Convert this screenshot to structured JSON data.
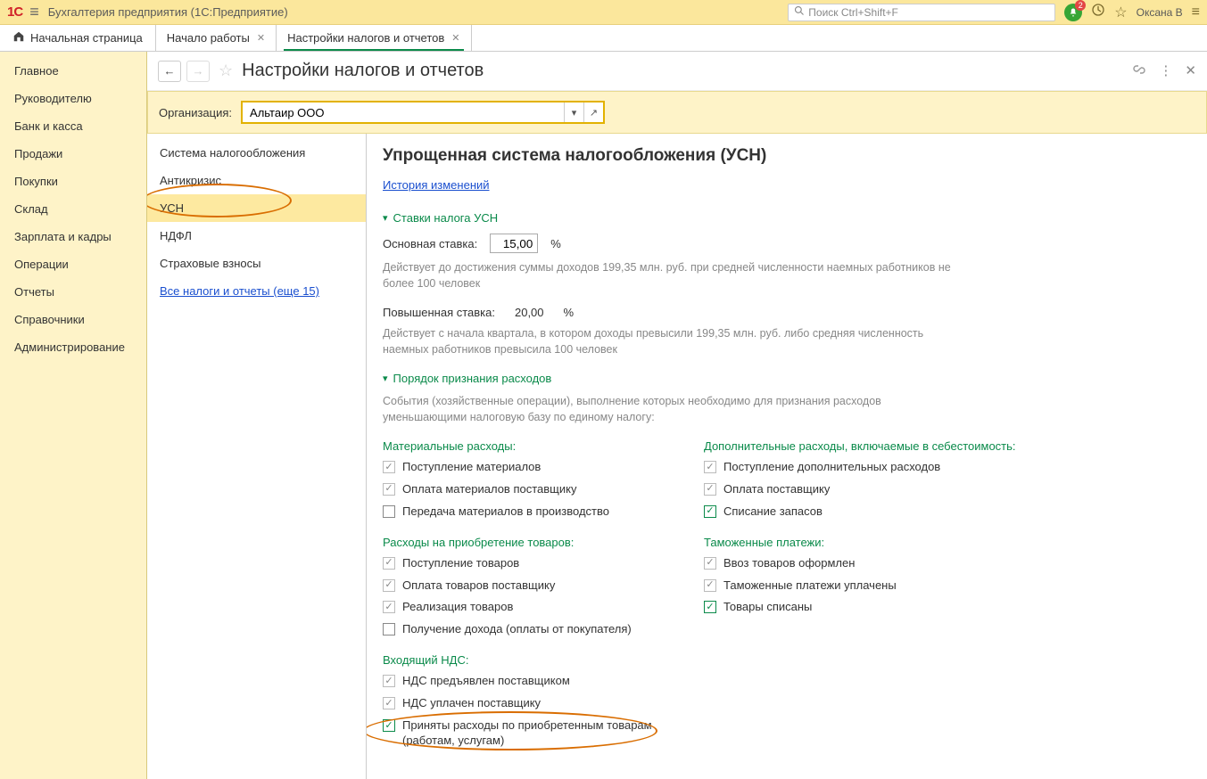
{
  "titlebar": {
    "app_title": "Бухгалтерия предприятия  (1С:Предприятие)",
    "search_placeholder": "Поиск Ctrl+Shift+F",
    "notification_count": "2",
    "username": "Оксана В"
  },
  "tabs": {
    "home": "Начальная страница",
    "items": [
      {
        "label": "Начало работы"
      },
      {
        "label": "Настройки налогов и отчетов"
      }
    ]
  },
  "leftnav": [
    "Главное",
    "Руководителю",
    "Банк и касса",
    "Продажи",
    "Покупки",
    "Склад",
    "Зарплата и кадры",
    "Операции",
    "Отчеты",
    "Справочники",
    "Администрирование"
  ],
  "content": {
    "title": "Настройки налогов и отчетов",
    "org_label": "Организация:",
    "org_value": "Альтаир ООО"
  },
  "settings_nav": [
    {
      "label": "Система налогообложения"
    },
    {
      "label": "Антикризис"
    },
    {
      "label": "УСН",
      "active": true
    },
    {
      "label": "НДФЛ"
    },
    {
      "label": "Страховые взносы"
    },
    {
      "label": "Все налоги и отчеты (еще 15)",
      "link": true
    }
  ],
  "usn": {
    "heading": "Упрощенная система налогообложения (УСН)",
    "history_link": "История изменений",
    "rates_section": "Ставки налога УСН",
    "main_rate_label": "Основная ставка:",
    "main_rate_value": "15,00",
    "percent": "%",
    "main_rate_hint": "Действует до достижения суммы доходов 199,35 млн. руб. при средней численности наемных работников не более 100 человек",
    "hi_rate_label": "Повышенная ставка:",
    "hi_rate_value": "20,00",
    "hi_rate_hint": "Действует с начала квартала, в котором доходы превысили 199,35 млн. руб. либо средняя численность наемных работников превысила 100 человек",
    "expenses_section": "Порядок признания расходов",
    "expenses_hint": "События (хозяйственные операции), выполнение которых необходимо для признания расходов уменьшающими налоговую базу по единому налогу:",
    "col1_h1": "Материальные расходы:",
    "col1_items1": [
      {
        "label": "Поступление материалов",
        "locked": true
      },
      {
        "label": "Оплата материалов поставщику",
        "locked": true
      },
      {
        "label": "Передача материалов в производство",
        "checked": false
      }
    ],
    "col1_h2": "Расходы на приобретение товаров:",
    "col1_items2": [
      {
        "label": "Поступление товаров",
        "locked": true
      },
      {
        "label": "Оплата товаров поставщику",
        "locked": true
      },
      {
        "label": "Реализация товаров",
        "locked": true
      },
      {
        "label": "Получение дохода (оплаты от покупателя)",
        "checked": false
      }
    ],
    "col1_h3": "Входящий НДС:",
    "col1_items3": [
      {
        "label": "НДС предъявлен поставщиком",
        "locked": true
      },
      {
        "label": "НДС уплачен поставщику",
        "locked": true
      },
      {
        "label": "Приняты расходы по приобретенным товарам (работам, услугам)",
        "checked": true
      }
    ],
    "col2_h1": "Дополнительные расходы, включаемые в себестоимость:",
    "col2_items1": [
      {
        "label": "Поступление дополнительных расходов",
        "locked": true
      },
      {
        "label": "Оплата поставщику",
        "locked": true
      },
      {
        "label": "Списание запасов",
        "checked": true
      }
    ],
    "col2_h2": "Таможенные платежи:",
    "col2_items2": [
      {
        "label": "Ввоз товаров оформлен",
        "locked": true
      },
      {
        "label": "Таможенные платежи уплачены",
        "locked": true
      },
      {
        "label": "Товары списаны",
        "checked": true
      }
    ]
  }
}
